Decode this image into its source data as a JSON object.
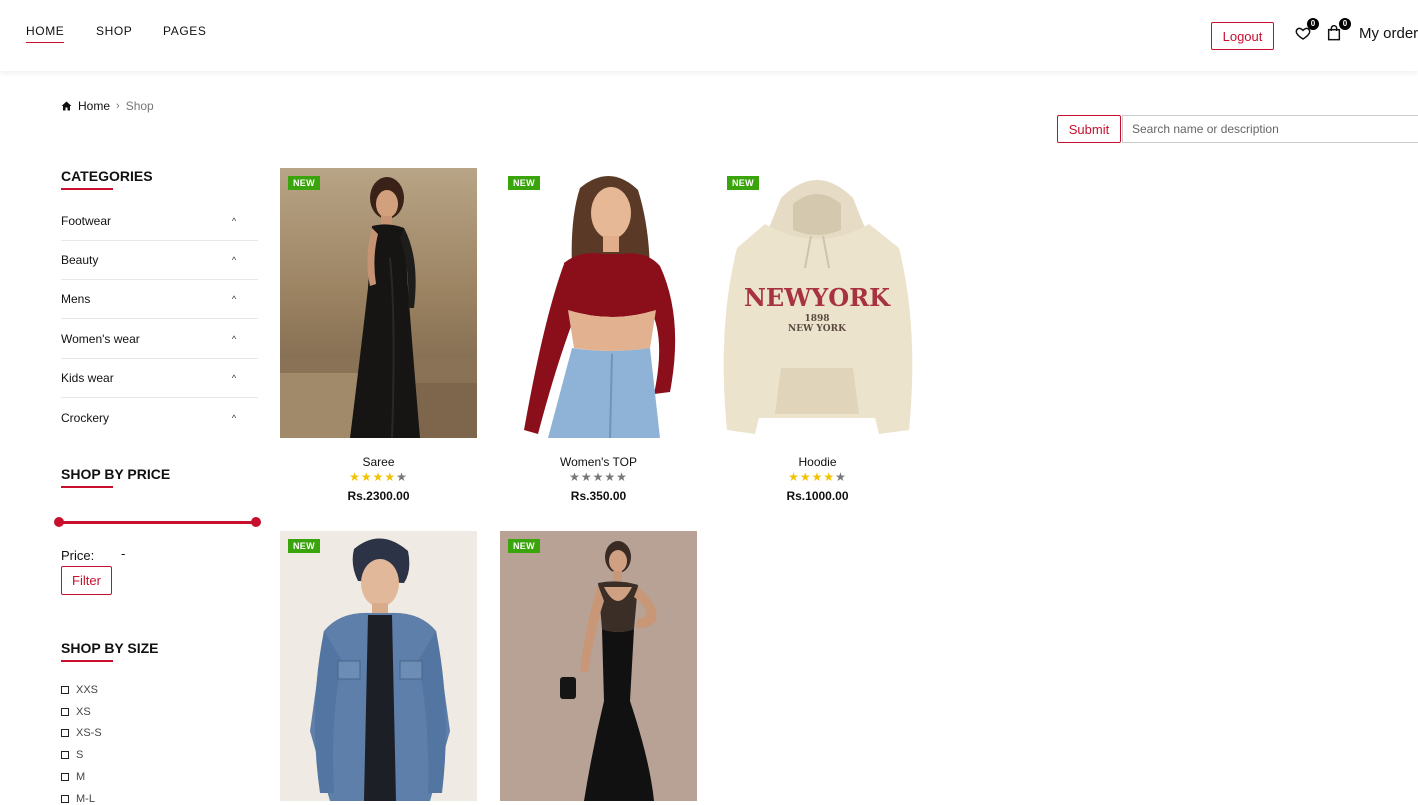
{
  "nav": {
    "items": [
      {
        "label": "HOME"
      },
      {
        "label": "SHOP"
      },
      {
        "label": "PAGES"
      }
    ],
    "logout_label": "Logout",
    "wishlist_count": "0",
    "cart_count": "0",
    "my_orders_label": "My order"
  },
  "breadcrumb": {
    "home": "Home",
    "current": "Shop"
  },
  "search": {
    "submit_label": "Submit",
    "placeholder": "Search name or description"
  },
  "sidebar": {
    "categories_heading": "CATEGORIES",
    "categories": [
      {
        "label": "Footwear"
      },
      {
        "label": "Beauty"
      },
      {
        "label": "Mens"
      },
      {
        "label": "Women's wear"
      },
      {
        "label": "Kids wear"
      },
      {
        "label": "Crockery"
      }
    ],
    "price_heading": "SHOP BY PRICE",
    "price_range_low_fraction": 0,
    "price_range_high_fraction": 1,
    "price_label": "Price:",
    "price_separator": "-",
    "filter_label": "Filter",
    "size_heading": "SHOP BY SIZE",
    "sizes": [
      {
        "label": "XXS"
      },
      {
        "label": "XS"
      },
      {
        "label": "XS-S"
      },
      {
        "label": "S"
      },
      {
        "label": "M"
      },
      {
        "label": "M-L"
      }
    ]
  },
  "products": [
    {
      "badge": "NEW",
      "name": "Saree",
      "rating": 4,
      "price": "Rs.2300.00",
      "image": "woman-black-saree-photo"
    },
    {
      "badge": "NEW",
      "name": "Women's TOP",
      "rating": 0,
      "price": "Rs.350.00",
      "image": "woman-red-crop-top-photo"
    },
    {
      "badge": "NEW",
      "name": "Hoodie",
      "rating": 4,
      "price": "Rs.1000.00",
      "image": "beige-new-york-hoodie-photo"
    },
    {
      "badge": "NEW",
      "name": "",
      "rating": 0,
      "price": "",
      "image": "man-denim-jacket-photo"
    },
    {
      "badge": "NEW",
      "name": "",
      "rating": 0,
      "price": "",
      "image": "woman-black-gown-photo"
    }
  ],
  "hoodie_print": {
    "line1": "NEWYORK",
    "line2": "1898",
    "line3": "NEW YORK"
  },
  "colors": {
    "accent": "#c8102e",
    "new_badge": "#3aa40c",
    "star_on": "#f2c200",
    "star_off": "#777777"
  }
}
